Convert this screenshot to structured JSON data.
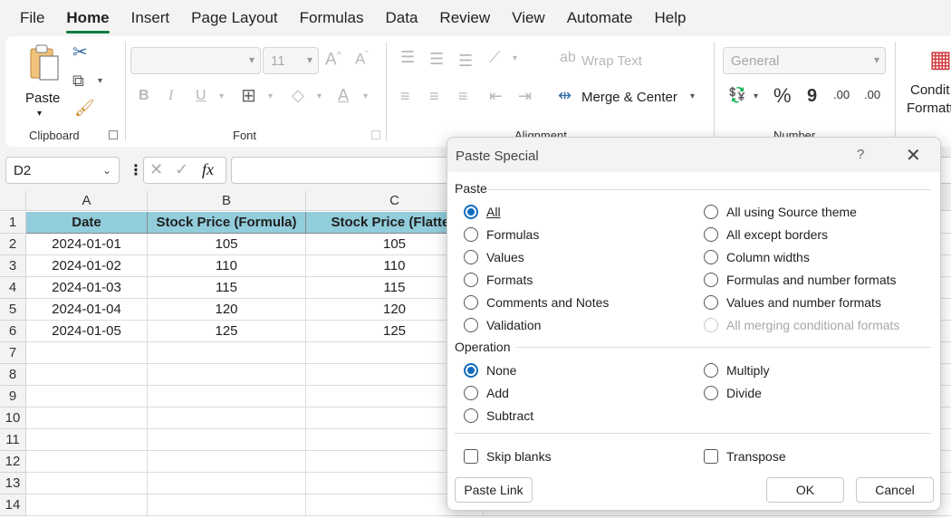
{
  "menu": [
    "File",
    "Home",
    "Insert",
    "Page Layout",
    "Formulas",
    "Data",
    "Review",
    "View",
    "Automate",
    "Help"
  ],
  "ribbon": {
    "clipboard": {
      "paste_label": "Paste",
      "group_label": "Clipboard"
    },
    "font": {
      "font_size": "11",
      "bold": "B",
      "italic": "I",
      "underline": "U",
      "group_label": "Font",
      "grow": "A^",
      "shrink": "Aˇ"
    },
    "alignment": {
      "wrap_text": "Wrap Text",
      "merge_center": "Merge & Center",
      "group_label": "Alignment"
    },
    "number": {
      "format": "General",
      "percent": "%",
      "comma": "9",
      "group_label": "Number",
      "inc_decimal": ".00",
      "dec_decimal": ".00"
    },
    "styles": {
      "cond_format_line1": "Condit",
      "cond_format_line2": "Formatt"
    }
  },
  "formula_bar": {
    "name_box": "D2",
    "fx": "fx",
    "value": ""
  },
  "grid": {
    "columns": [
      "A",
      "B",
      "C"
    ],
    "rows": [
      "1",
      "2",
      "3",
      "4",
      "5",
      "6",
      "7",
      "8",
      "9",
      "10",
      "11",
      "12",
      "13",
      "14"
    ],
    "header": [
      "Date",
      "Stock Price (Formula)",
      "Stock Price (Flatten"
    ],
    "data": [
      [
        "2024-01-01",
        "105",
        "105"
      ],
      [
        "2024-01-02",
        "110",
        "110"
      ],
      [
        "2024-01-03",
        "115",
        "115"
      ],
      [
        "2024-01-04",
        "120",
        "120"
      ],
      [
        "2024-01-05",
        "125",
        "125"
      ]
    ]
  },
  "dialog": {
    "title": "Paste Special",
    "help": "?",
    "close": "✕",
    "paste_section": "Paste",
    "paste_left": [
      "All",
      "Formulas",
      "Values",
      "Formats",
      "Comments and Notes",
      "Validation"
    ],
    "paste_right": [
      "All using Source theme",
      "All except borders",
      "Column widths",
      "Formulas and number formats",
      "Values and number formats",
      "All merging conditional formats"
    ],
    "operation_section": "Operation",
    "op_left": [
      "None",
      "Add",
      "Subtract"
    ],
    "op_right": [
      "Multiply",
      "Divide"
    ],
    "skip_blanks": "Skip blanks",
    "transpose": "Transpose",
    "paste_link": "Paste Link",
    "ok": "OK",
    "cancel": "Cancel"
  },
  "colors": {
    "accent": "#107c41",
    "header_fill": "#92cddc",
    "radio_selected": "#0f6cbd"
  }
}
